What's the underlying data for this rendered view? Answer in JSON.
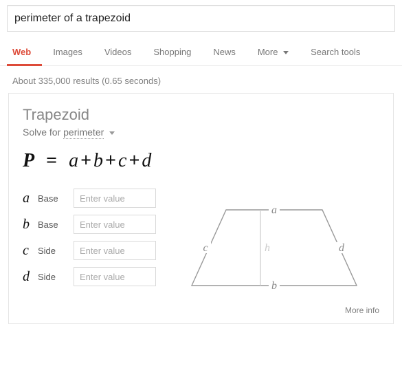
{
  "search": {
    "query": "perimeter of a trapezoid"
  },
  "tabs": {
    "web": "Web",
    "images": "Images",
    "videos": "Videos",
    "shopping": "Shopping",
    "news": "News",
    "more": "More",
    "tools": "Search tools"
  },
  "stats": "About 335,000 results (0.65 seconds)",
  "card": {
    "title": "Trapezoid",
    "solve_label": "Solve for",
    "solve_value": "perimeter",
    "formula": {
      "lhs": "P",
      "rhs": [
        "a",
        "b",
        "c",
        "d"
      ]
    },
    "inputs": [
      {
        "var": "a",
        "label": "Base",
        "placeholder": "Enter value"
      },
      {
        "var": "b",
        "label": "Base",
        "placeholder": "Enter value"
      },
      {
        "var": "c",
        "label": "Side",
        "placeholder": "Enter value"
      },
      {
        "var": "d",
        "label": "Side",
        "placeholder": "Enter value"
      }
    ],
    "diagram_labels": {
      "a": "a",
      "b": "b",
      "c": "c",
      "d": "d",
      "h": "h"
    },
    "more_info": "More info"
  }
}
